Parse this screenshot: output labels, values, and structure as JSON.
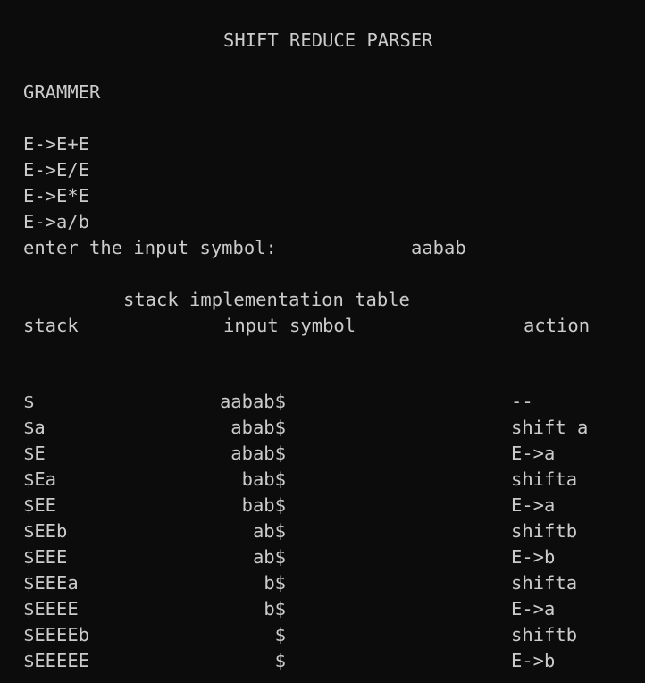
{
  "title": "SHIFT REDUCE PARSER",
  "grammar_heading": "GRAMMER",
  "grammar": [
    "E->E+E",
    "E->E/E",
    "E->E*E",
    "E->a/b"
  ],
  "prompt": "enter the input symbol:",
  "input_value": "aabab",
  "table_title": "stack implementation table",
  "headers": {
    "stack": "stack",
    "input": "input symbol",
    "action": "action"
  },
  "rows": [
    {
      "stack": "$",
      "input": "aabab$",
      "action": "--"
    },
    {
      "stack": "$a",
      "input": "abab$",
      "action": "shift a"
    },
    {
      "stack": "$E",
      "input": "abab$",
      "action": "E->a"
    },
    {
      "stack": "$Ea",
      "input": "bab$",
      "action": "shifta"
    },
    {
      "stack": "$EE",
      "input": "bab$",
      "action": "E->a"
    },
    {
      "stack": "$EEb",
      "input": "ab$",
      "action": "shiftb"
    },
    {
      "stack": "$EEE",
      "input": "ab$",
      "action": "E->b"
    },
    {
      "stack": "$EEEa",
      "input": "b$",
      "action": "shifta"
    },
    {
      "stack": "$EEEE",
      "input": "b$",
      "action": "E->a"
    },
    {
      "stack": "$EEEEb",
      "input": "$",
      "action": "shiftb"
    },
    {
      "stack": "$EEEEE",
      "input": "$",
      "action": "E->b"
    }
  ]
}
